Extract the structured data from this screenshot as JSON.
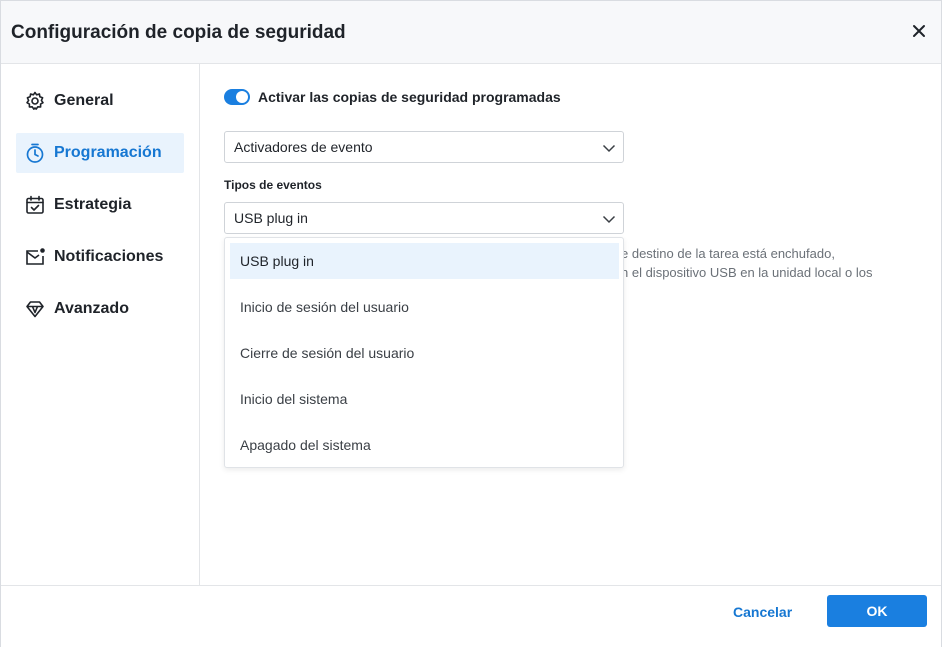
{
  "dialog": {
    "title": "Configuración de copia de seguridad",
    "close_icon": "close-icon"
  },
  "sidebar": {
    "items": [
      {
        "label": "General",
        "icon": "gear-icon",
        "active": false
      },
      {
        "label": "Programación",
        "icon": "timer-icon",
        "active": true
      },
      {
        "label": "Estrategia",
        "icon": "calendar-check-icon",
        "active": false
      },
      {
        "label": "Notificaciones",
        "icon": "mail-notification-icon",
        "active": false
      },
      {
        "label": "Avanzado",
        "icon": "diamond-icon",
        "active": false
      }
    ]
  },
  "main": {
    "toggle_label": "Activar las copias de seguridad programadas",
    "toggle_on": true,
    "trigger_select": {
      "value": "Activadores de evento"
    },
    "event_types_label": "Tipos de eventos",
    "event_select": {
      "value": "USB plug in"
    },
    "description_line1": "e destino de la tarea está enchufado,",
    "description_line2": "n el dispositivo USB en la unidad local o los",
    "dropdown_options": [
      {
        "label": "USB plug in",
        "selected": true
      },
      {
        "label": "Inicio de sesión del usuario",
        "selected": false
      },
      {
        "label": "Cierre de sesión del usuario",
        "selected": false
      },
      {
        "label": "Inicio del sistema",
        "selected": false
      },
      {
        "label": "Apagado del sistema",
        "selected": false
      }
    ]
  },
  "footer": {
    "cancel_label": "Cancelar",
    "ok_label": "OK"
  },
  "colors": {
    "accent": "#1a7fe0",
    "active_bg": "#e9f3fd"
  }
}
